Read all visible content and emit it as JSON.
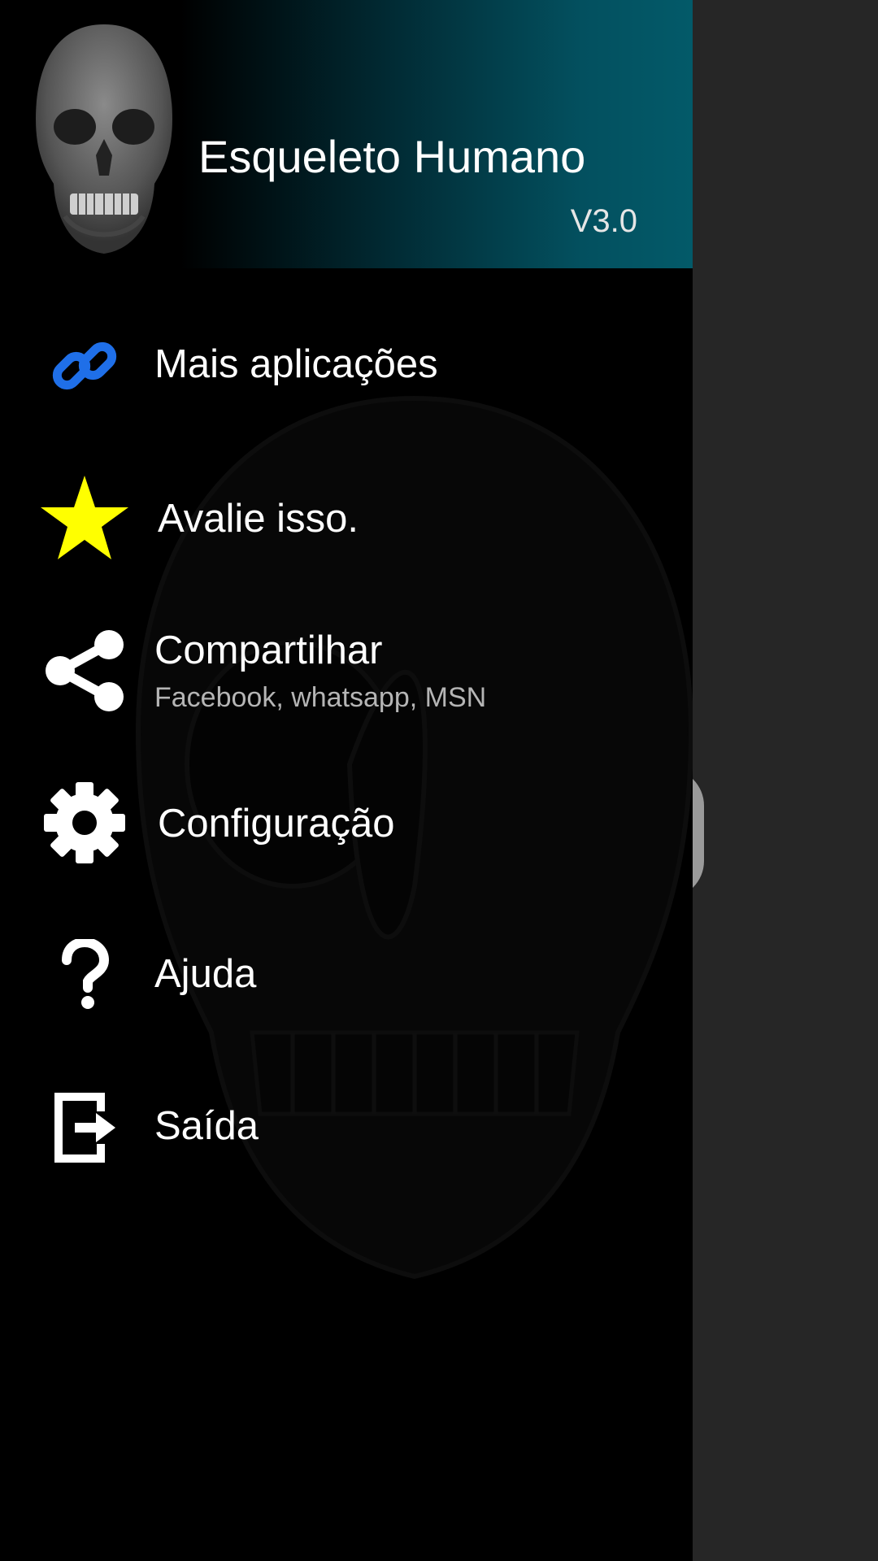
{
  "header": {
    "title": "Esqueleto Humano",
    "version": "V3.0",
    "logo_icon": "skull-icon"
  },
  "menu": {
    "items": [
      {
        "label": "Mais aplicações",
        "icon": "link-icon",
        "icon_color": "#1f6fe8"
      },
      {
        "label": "Avalie isso.",
        "icon": "star-icon",
        "icon_color": "#ffff00"
      },
      {
        "label": "Compartilhar",
        "sublabel": "Facebook, whatsapp, MSN",
        "icon": "share-icon",
        "icon_color": "#ffffff"
      },
      {
        "label": "Configuração",
        "icon": "gear-icon",
        "icon_color": "#ffffff"
      },
      {
        "label": "Ajuda",
        "icon": "question-icon",
        "icon_color": "#ffffff"
      },
      {
        "label": "Saída",
        "icon": "exit-icon",
        "icon_color": "#ffffff"
      }
    ]
  },
  "colors": {
    "drawer_background": "#000000",
    "header_gradient_end": "#035a69",
    "scrim": "#262626"
  }
}
